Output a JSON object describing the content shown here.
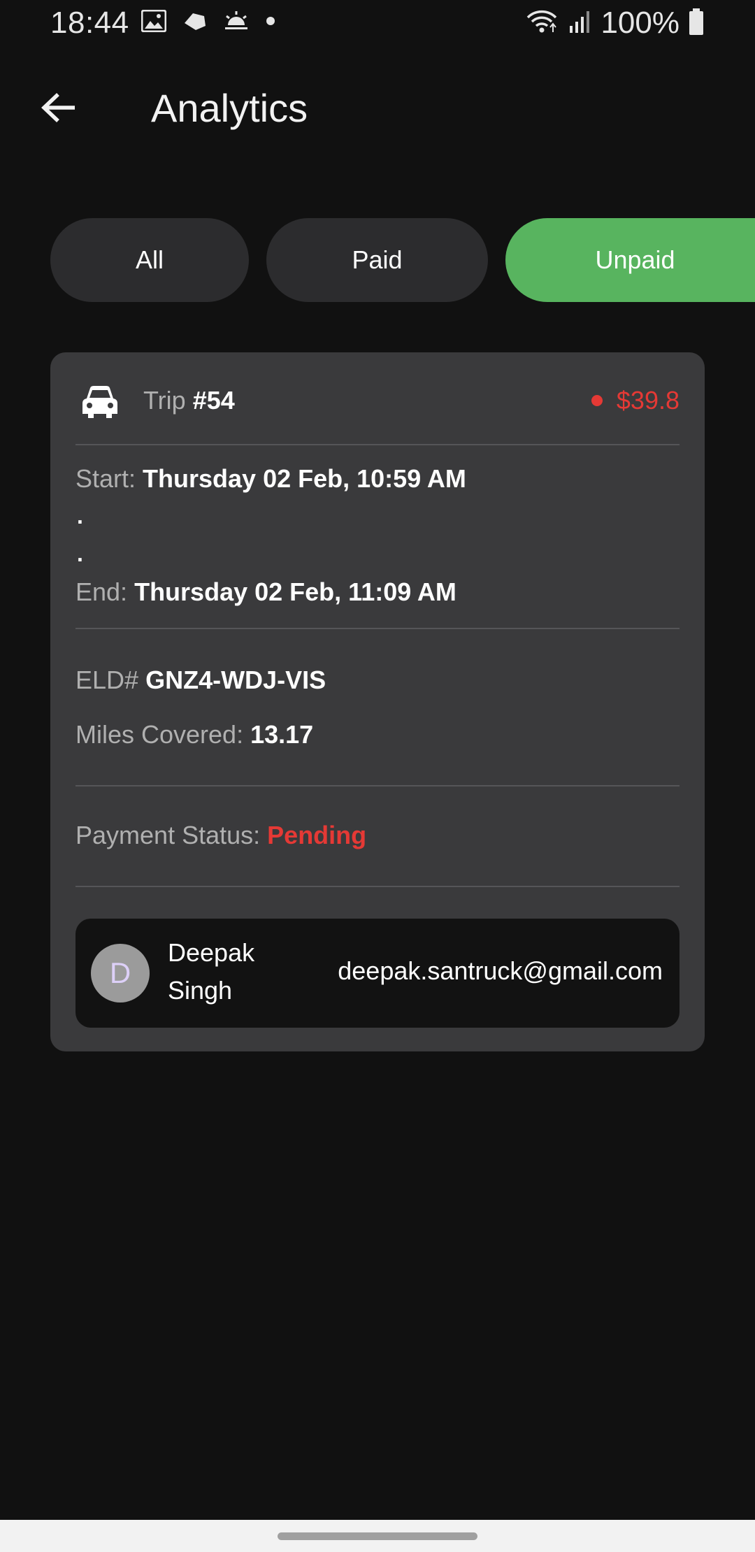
{
  "status_bar": {
    "time": "18:44",
    "battery": "100%",
    "left_icons": [
      "image-icon",
      "cloud-icon",
      "sunrise-icon",
      "dot-icon"
    ],
    "right_icons": [
      "wifi-icon",
      "signal-icon",
      "battery-icon"
    ]
  },
  "app_bar": {
    "title": "Analytics",
    "back_icon": "arrow-left-icon"
  },
  "filters": {
    "tabs": [
      {
        "label": "All",
        "active": false
      },
      {
        "label": "Paid",
        "active": false
      },
      {
        "label": "Unpaid",
        "active": true
      }
    ],
    "active_color": "#58b45f"
  },
  "trip": {
    "icon": "car-icon",
    "trip_prefix": "Trip",
    "trip_number": "#54",
    "amount": "$39.8",
    "start_label": "Start:",
    "start_value": "Thursday 02 Feb, 10:59 AM",
    "dot": ".",
    "end_label": "End:",
    "end_value": "Thursday 02 Feb, 11:09 AM",
    "eld_label": "ELD#",
    "eld_value": "GNZ4-WDJ-VIS",
    "miles_label": "Miles Covered:",
    "miles_value": "13.17",
    "payment_label": "Payment Status:",
    "payment_value": "Pending",
    "status_color": "#e53935"
  },
  "user": {
    "avatar_letter": "D",
    "name": "Deepak Singh",
    "email": "deepak.santruck@gmail.com"
  }
}
